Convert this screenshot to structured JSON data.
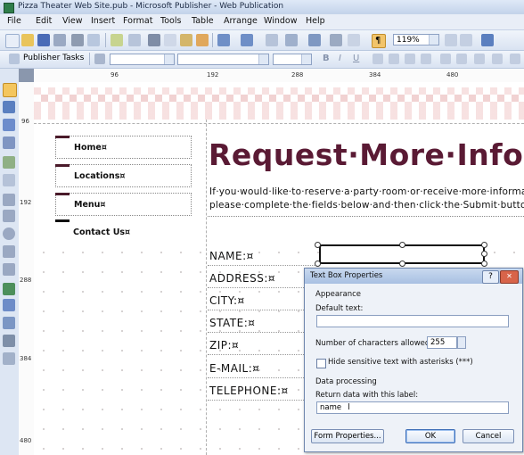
{
  "window": {
    "title": "Pizza Theater Web Site.pub - Microsoft Publisher - Web Publication"
  },
  "menubar": [
    "File",
    "Edit",
    "View",
    "Insert",
    "Format",
    "Tools",
    "Table",
    "Arrange",
    "Window",
    "Help"
  ],
  "toolbar": {
    "zoom": "119%",
    "task_pane_label": "Publisher Tasks"
  },
  "ruler": {
    "horizontal": [
      "96",
      "192",
      "288",
      "384",
      "480"
    ],
    "vertical": [
      "96",
      "192",
      "288",
      "384",
      "480"
    ]
  },
  "page": {
    "nav": [
      "Home¤",
      "Locations¤",
      "Menu¤",
      "Contact Us¤"
    ],
    "heading": "Request·More·Info",
    "intro_line1": "If·you·would·like·to·reserve·a·party·room·or·receive·more·informa",
    "intro_line2": "please·complete·the·fields·below·and·then·click·the·Submit·button",
    "fields": [
      "NAME:¤",
      "ADDRESS:¤",
      "CITY:¤",
      "STATE:¤",
      "ZIP:¤",
      "E-MAIL:¤",
      "TELEPHONE:¤"
    ]
  },
  "dialog": {
    "title": "Text Box Properties",
    "appearance_label": "Appearance",
    "default_text_label": "Default text:",
    "default_text_value": "",
    "num_chars_label": "Number of characters allowed:",
    "num_chars_value": "255",
    "hide_text_label": "Hide sensitive text with asterisks (***)",
    "data_processing_label": "Data processing",
    "return_label": "Return data with this label:",
    "return_value": "name",
    "form_properties_button": "Form Properties...",
    "ok_button": "OK",
    "cancel_button": "Cancel",
    "help_symbol": "?",
    "close_symbol": "✕"
  },
  "colors": {
    "heading": "#5a1a34",
    "accent": "#4a1a2a"
  }
}
